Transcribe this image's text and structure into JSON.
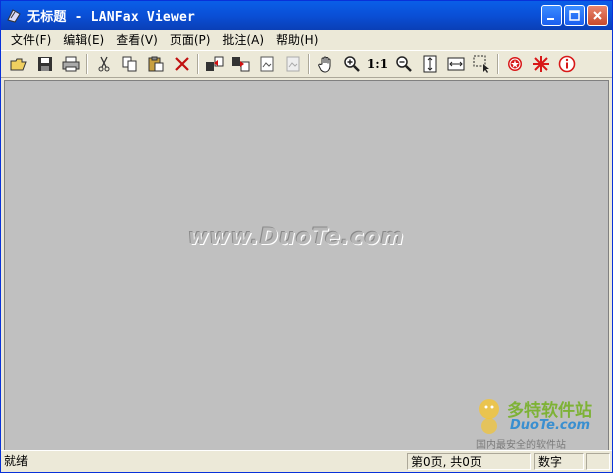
{
  "window": {
    "title": "无标题 - LANFax Viewer",
    "controls": [
      "minimize",
      "maximize",
      "close"
    ]
  },
  "menu": [
    {
      "label": "文件(F)"
    },
    {
      "label": "编辑(E)"
    },
    {
      "label": "查看(V)"
    },
    {
      "label": "页面(P)"
    },
    {
      "label": "批注(A)"
    },
    {
      "label": "帮助(H)"
    }
  ],
  "toolbar": {
    "icons": [
      "open-folder-icon",
      "save-icon",
      "print-icon",
      "cut-icon",
      "copy-icon",
      "paste-icon",
      "delete-icon",
      "prev-page-icon",
      "next-page-icon",
      "image-icon",
      "image-disabled-icon",
      "hand-icon",
      "zoom-in-icon",
      "actual-size-icon",
      "zoom-out-icon",
      "fit-height-icon",
      "fit-width-icon",
      "select-icon",
      "stamp-icon",
      "burst-icon",
      "info-icon"
    ],
    "actual_size_label": "1:1"
  },
  "content": {
    "watermark": "www.DuoTe.com"
  },
  "corner_logo": {
    "line1": "多特软件站",
    "line2": "DuoTe.com",
    "line3": "国内最安全的软件站"
  },
  "status": {
    "main": "就绪",
    "page": "第0页, 共0页",
    "mode": "数字"
  },
  "colors": {
    "titlebar": "#0a4fd6",
    "client_bg": "#c0c0c0",
    "chrome": "#ece9d8"
  }
}
